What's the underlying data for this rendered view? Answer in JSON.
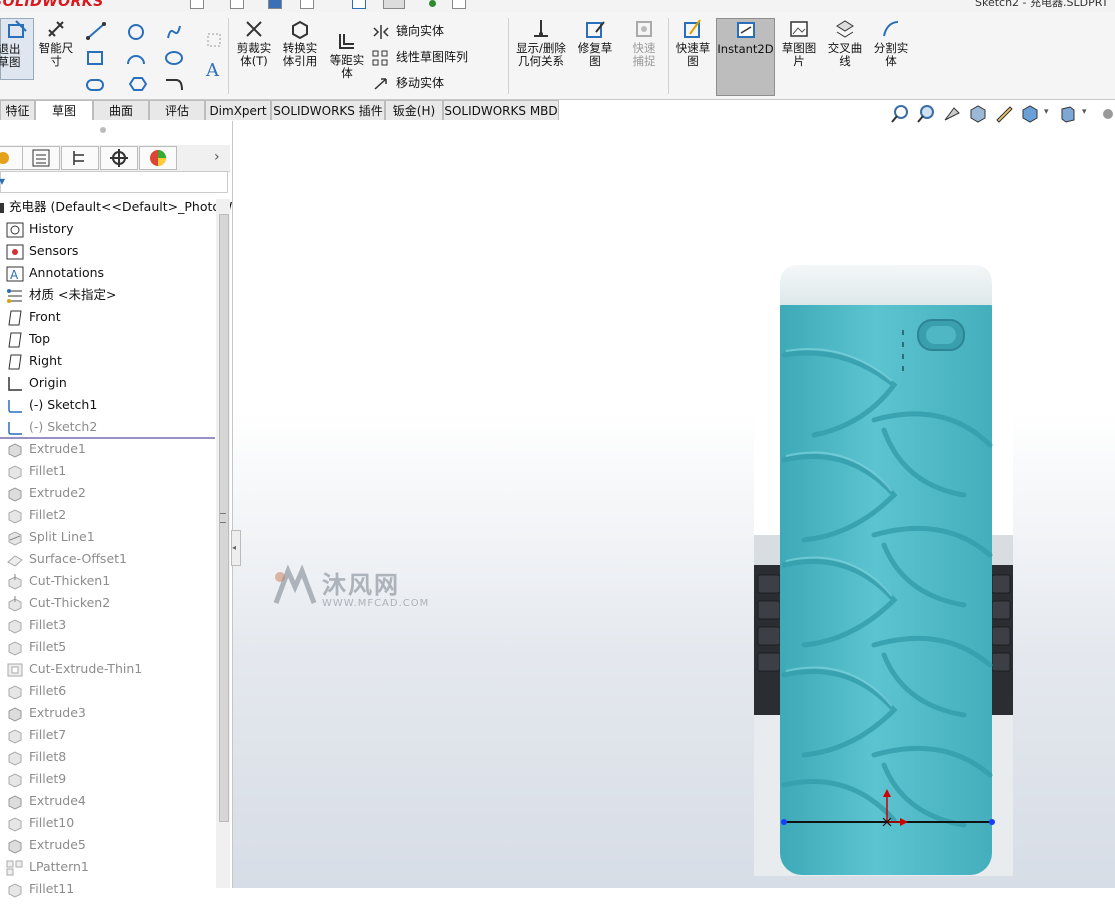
{
  "app": {
    "brand": "SOLIDWORKS",
    "doc_title": "Sketch2 - 充电器.SLDPRT"
  },
  "ribbon": {
    "exit_sketch": "退出草图",
    "smart_dimension": "智能尺寸",
    "trim": "剪裁实体(T)",
    "convert": "转换实体引用",
    "offset": "等距实体",
    "mirror": "镜向实体",
    "linear_pattern": "线性草图阵列",
    "move": "移动实体",
    "display_relations": "显示/删除几何关系",
    "repair": "修复草图",
    "quick_snaps": "快速捕捉",
    "rapid_sketch": "快速草图",
    "instant2d": "Instant2D",
    "sketch_picture": "草图图片",
    "intersection_curve": "交叉曲线",
    "split_body": "分割实体"
  },
  "tabs": [
    "特征",
    "草图",
    "曲面",
    "评估",
    "DimXpert",
    "SOLIDWORKS 插件",
    "钣金(H)",
    "SOLIDWORKS MBD"
  ],
  "tree": {
    "root": "充电器  (Default<<Default>_PhotoW",
    "items": [
      {
        "label": "History",
        "icon": "history-icon",
        "dim": false
      },
      {
        "label": "Sensors",
        "icon": "sensors-icon",
        "dim": false
      },
      {
        "label": "Annotations",
        "icon": "annotations-icon",
        "dim": false
      },
      {
        "label": "材质 <未指定>",
        "icon": "material-icon",
        "dim": false
      },
      {
        "label": "Front",
        "icon": "plane-icon",
        "dim": false
      },
      {
        "label": "Top",
        "icon": "plane-icon",
        "dim": false
      },
      {
        "label": "Right",
        "icon": "plane-icon",
        "dim": false
      },
      {
        "label": "Origin",
        "icon": "origin-icon",
        "dim": false
      },
      {
        "label": "(-) Sketch1",
        "icon": "sketch-icon",
        "dim": false
      },
      {
        "label": "(-) Sketch2",
        "icon": "sketch-icon",
        "dim": true
      },
      {
        "label": "Extrude1",
        "icon": "extrude-icon",
        "dim": true
      },
      {
        "label": "Fillet1",
        "icon": "fillet-icon",
        "dim": true
      },
      {
        "label": "Extrude2",
        "icon": "extrude-icon",
        "dim": true
      },
      {
        "label": "Fillet2",
        "icon": "fillet-icon",
        "dim": true
      },
      {
        "label": "Split Line1",
        "icon": "split-line-icon",
        "dim": true
      },
      {
        "label": "Surface-Offset1",
        "icon": "surface-offset-icon",
        "dim": true
      },
      {
        "label": "Cut-Thicken1",
        "icon": "cut-thicken-icon",
        "dim": true
      },
      {
        "label": "Cut-Thicken2",
        "icon": "cut-thicken-icon",
        "dim": true
      },
      {
        "label": "Fillet3",
        "icon": "fillet-icon",
        "dim": true
      },
      {
        "label": "Fillet5",
        "icon": "fillet-icon",
        "dim": true
      },
      {
        "label": "Cut-Extrude-Thin1",
        "icon": "cut-extrude-icon",
        "dim": true
      },
      {
        "label": "Fillet6",
        "icon": "fillet-icon",
        "dim": true
      },
      {
        "label": "Extrude3",
        "icon": "extrude-icon",
        "dim": true
      },
      {
        "label": "Fillet7",
        "icon": "fillet-icon",
        "dim": true
      },
      {
        "label": "Fillet8",
        "icon": "fillet-icon",
        "dim": true
      },
      {
        "label": "Fillet9",
        "icon": "fillet-icon",
        "dim": true
      },
      {
        "label": "Extrude4",
        "icon": "extrude-icon",
        "dim": true
      },
      {
        "label": "Fillet10",
        "icon": "fillet-icon",
        "dim": true
      },
      {
        "label": "Extrude5",
        "icon": "extrude-icon",
        "dim": true
      },
      {
        "label": "LPattern1",
        "icon": "pattern-icon",
        "dim": true
      },
      {
        "label": "Fillet11",
        "icon": "fillet-icon",
        "dim": true
      }
    ]
  },
  "watermark": {
    "cn": "沐风网",
    "url": "WWW.MFCAD.COM"
  },
  "colors": {
    "brand": "#d71920",
    "body_teal": "#4db9c6",
    "dim_text": "#8c8c8c"
  }
}
